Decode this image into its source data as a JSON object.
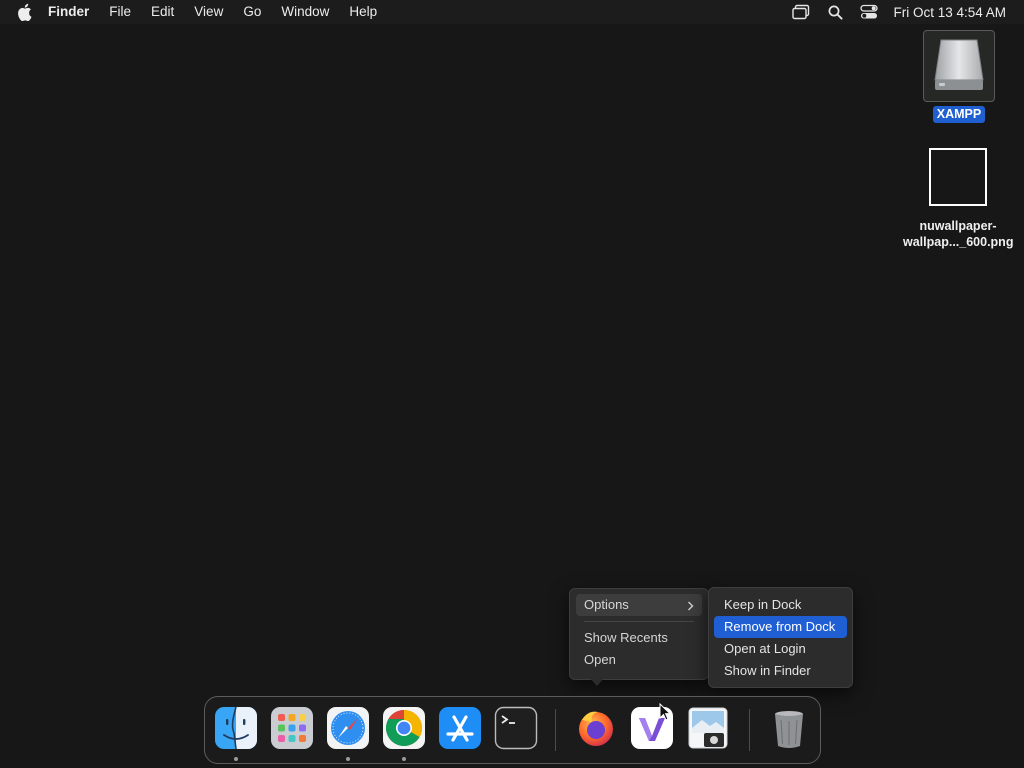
{
  "menubar": {
    "app_name": "Finder",
    "items": [
      "File",
      "Edit",
      "View",
      "Go",
      "Window",
      "Help"
    ],
    "clock": "Fri Oct 13  4:54 AM",
    "status_icons": [
      "screen-mirroring-icon",
      "search-icon",
      "control-center-icon"
    ]
  },
  "desktop_items": [
    {
      "label": "XAMPP",
      "icon": "external-drive-icon",
      "selected": true
    },
    {
      "label_line1": "nuwallpaper-",
      "label_line2": "wallpap..._600.png",
      "icon": "image-file-icon"
    }
  ],
  "context_menu": {
    "items": [
      {
        "label": "Options",
        "has_submenu": true,
        "hovered": true
      },
      {
        "label": "Show Recents"
      },
      {
        "label": "Open"
      }
    ],
    "submenu": [
      {
        "label": "Keep in Dock"
      },
      {
        "label": "Remove from Dock",
        "selected": true
      },
      {
        "label": "Open at Login"
      },
      {
        "label": "Show in Finder"
      }
    ]
  },
  "dock": {
    "apps": [
      {
        "name": "finder-icon",
        "running": true
      },
      {
        "name": "launchpad-icon",
        "running": false
      },
      {
        "name": "safari-icon",
        "running": true
      },
      {
        "name": "chrome-icon",
        "running": true
      },
      {
        "name": "app-store-icon",
        "running": false
      },
      {
        "name": "terminal-icon",
        "running": false
      },
      {
        "name": "firefox-icon",
        "running": false
      },
      {
        "name": "visual-studio-icon",
        "running": false
      },
      {
        "name": "preview-icon",
        "running": false
      },
      {
        "name": "trash-icon",
        "running": false
      }
    ]
  },
  "colors": {
    "desktop_bg": "#161716",
    "menu_highlight": "#1f5fd3",
    "selection_label": "#1f5fcf"
  }
}
